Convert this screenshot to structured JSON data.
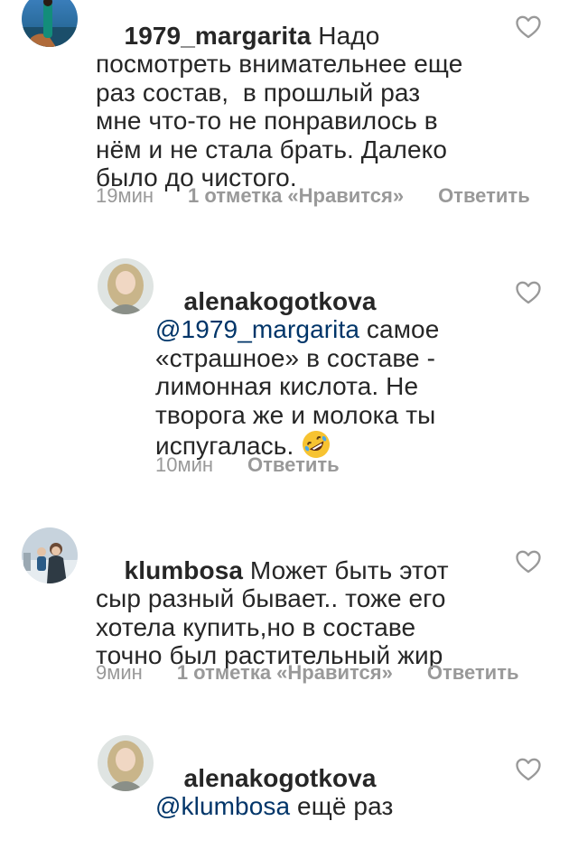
{
  "comments": [
    {
      "username": "1979_margarita",
      "text": " Надо\nпосмотреть внимательнее еще\nраз состав,  в прошлый раз\nмне что-то не понравилось в\nнём и не стала брать. Далеко\nбыло до чистого.",
      "time": "19мин",
      "likes": "1 отметка «Нравится»",
      "reply": "Ответить"
    },
    {
      "username": "alenakogotkova",
      "mention": "@1979_margarita",
      "text": " самое\n«страшное» в составе -\nлимонная кислота. Не\nтворога же и молока ты\nиспугалась. ",
      "emoji": "rolling-on-floor-laughing-emoji",
      "time": "10мин",
      "reply": "Ответить"
    },
    {
      "username": "klumbosa",
      "text": " Может быть этот\nсыр разный бывает.. тоже его\nхотела купить,но в составе\nточно был растительный жир",
      "time": "9мин",
      "likes": "1 отметка «Нравится»",
      "reply": "Ответить"
    },
    {
      "username": "alenakogotkova",
      "mention": "@klumbosa",
      "text": " ещё раз"
    }
  ],
  "icons": {
    "like": "heart-outline-icon"
  },
  "colors": {
    "mention": "#003569",
    "meta": "#999999",
    "text": "#262626"
  }
}
